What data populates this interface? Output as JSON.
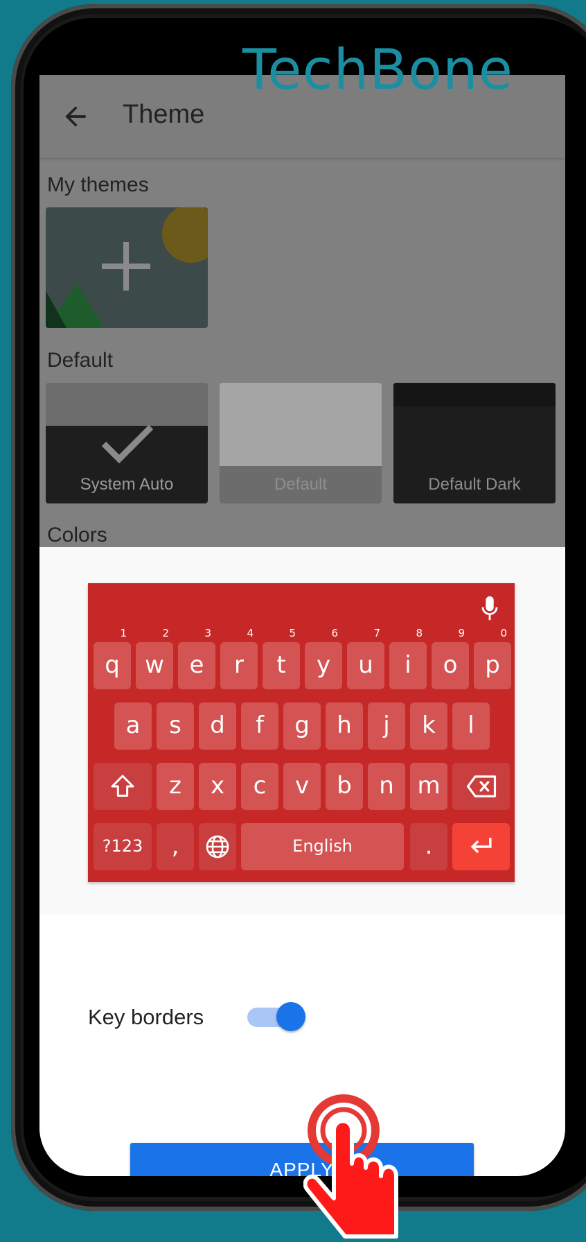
{
  "watermark": "TechBone",
  "appbar": {
    "title": "Theme"
  },
  "sections": {
    "my_themes": "My themes",
    "default": "Default",
    "colors": "Colors"
  },
  "default_themes": [
    {
      "label": "System Auto",
      "selected": true
    },
    {
      "label": "Default",
      "selected": false
    },
    {
      "label": "Default Dark",
      "selected": false
    }
  ],
  "keyboard": {
    "color": "#c62828",
    "row1": [
      {
        "k": "q",
        "h": "1"
      },
      {
        "k": "w",
        "h": "2"
      },
      {
        "k": "e",
        "h": "3"
      },
      {
        "k": "r",
        "h": "4"
      },
      {
        "k": "t",
        "h": "5"
      },
      {
        "k": "y",
        "h": "6"
      },
      {
        "k": "u",
        "h": "7"
      },
      {
        "k": "i",
        "h": "8"
      },
      {
        "k": "o",
        "h": "9"
      },
      {
        "k": "p",
        "h": "0"
      }
    ],
    "row2": [
      "a",
      "s",
      "d",
      "f",
      "g",
      "h",
      "j",
      "k",
      "l"
    ],
    "row3": [
      "z",
      "x",
      "c",
      "v",
      "b",
      "n",
      "m"
    ],
    "symbols_key": "?123",
    "comma_key": ",",
    "space_key": "English",
    "period_key": "."
  },
  "key_borders": {
    "label": "Key borders",
    "enabled": true
  },
  "apply_button": "APPLY",
  "colors": {
    "accent": "#1a73e8",
    "enter_key": "#f44336"
  }
}
